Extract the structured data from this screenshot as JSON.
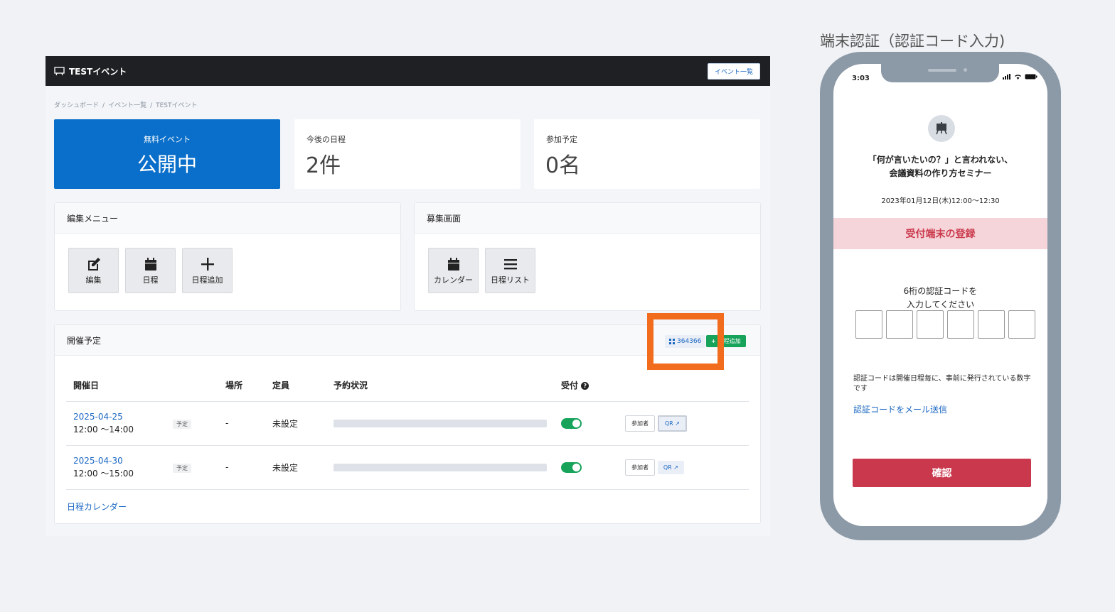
{
  "app": {
    "brand_title": "TESTイベント",
    "event_list_button": "イベント一覧",
    "breadcrumb": [
      "ダッシュボード",
      "イベント一覧",
      "TESTイベント"
    ],
    "stats": {
      "status_sub": "無料イベント",
      "status_main": "公開中",
      "upcoming_label": "今後の日程",
      "upcoming_value": "2件",
      "participants_label": "参加予定",
      "participants_value": "0名"
    },
    "edit_menu": {
      "title": "編集メニュー",
      "tiles": [
        "編集",
        "日程",
        "日程追加"
      ]
    },
    "recruit": {
      "title": "募集画面",
      "tiles": [
        "カレンダー",
        "日程リスト"
      ]
    },
    "schedule": {
      "title": "開催予定",
      "code_chip": "364366",
      "add_chip": "日程追加",
      "columns": [
        "開催日",
        "場所",
        "定員",
        "予約状況",
        "受付"
      ],
      "help_mark": "?",
      "rows": [
        {
          "date": "2025-04-25",
          "time": "12:00 〜14:00",
          "badge": "予定",
          "place": "-",
          "capacity": "未設定",
          "reservation_ratio": 0,
          "reception_on": true,
          "participants_btn": "参加者",
          "qr_btn": "QR"
        },
        {
          "date": "2025-04-30",
          "time": "12:00 〜15:00",
          "badge": "予定",
          "place": "-",
          "capacity": "未設定",
          "reservation_ratio": 0,
          "reception_on": true,
          "participants_btn": "参加者",
          "qr_btn": "QR"
        }
      ],
      "calendar_link": "日程カレンダー"
    }
  },
  "phone": {
    "caption": "端末認証（認証コード入力)",
    "status_time": "3:03",
    "event_title_line1": "「何が言いたいの？」と言われない、",
    "event_title_line2": "会議資料の作り方セミナー",
    "event_datetime": "2023年01月12日(木)12:00〜12:30",
    "register_band": "受付端末の登録",
    "prompt_line1": "6桁の認証コードを",
    "prompt_line2": "入力してください",
    "code_digits": [
      "",
      "",
      "",
      "",
      "",
      ""
    ],
    "note": "認証コードは開催日程毎に、事前に発行されている数字です",
    "mail_link": "認証コードをメール送信",
    "confirm_button": "確認"
  },
  "colors": {
    "primary_blue": "#0a6fca",
    "link_blue": "#1a67c3",
    "toggle_green": "#17a35a",
    "highlight_orange": "#f26c1e",
    "confirm_red": "#c9384d"
  }
}
